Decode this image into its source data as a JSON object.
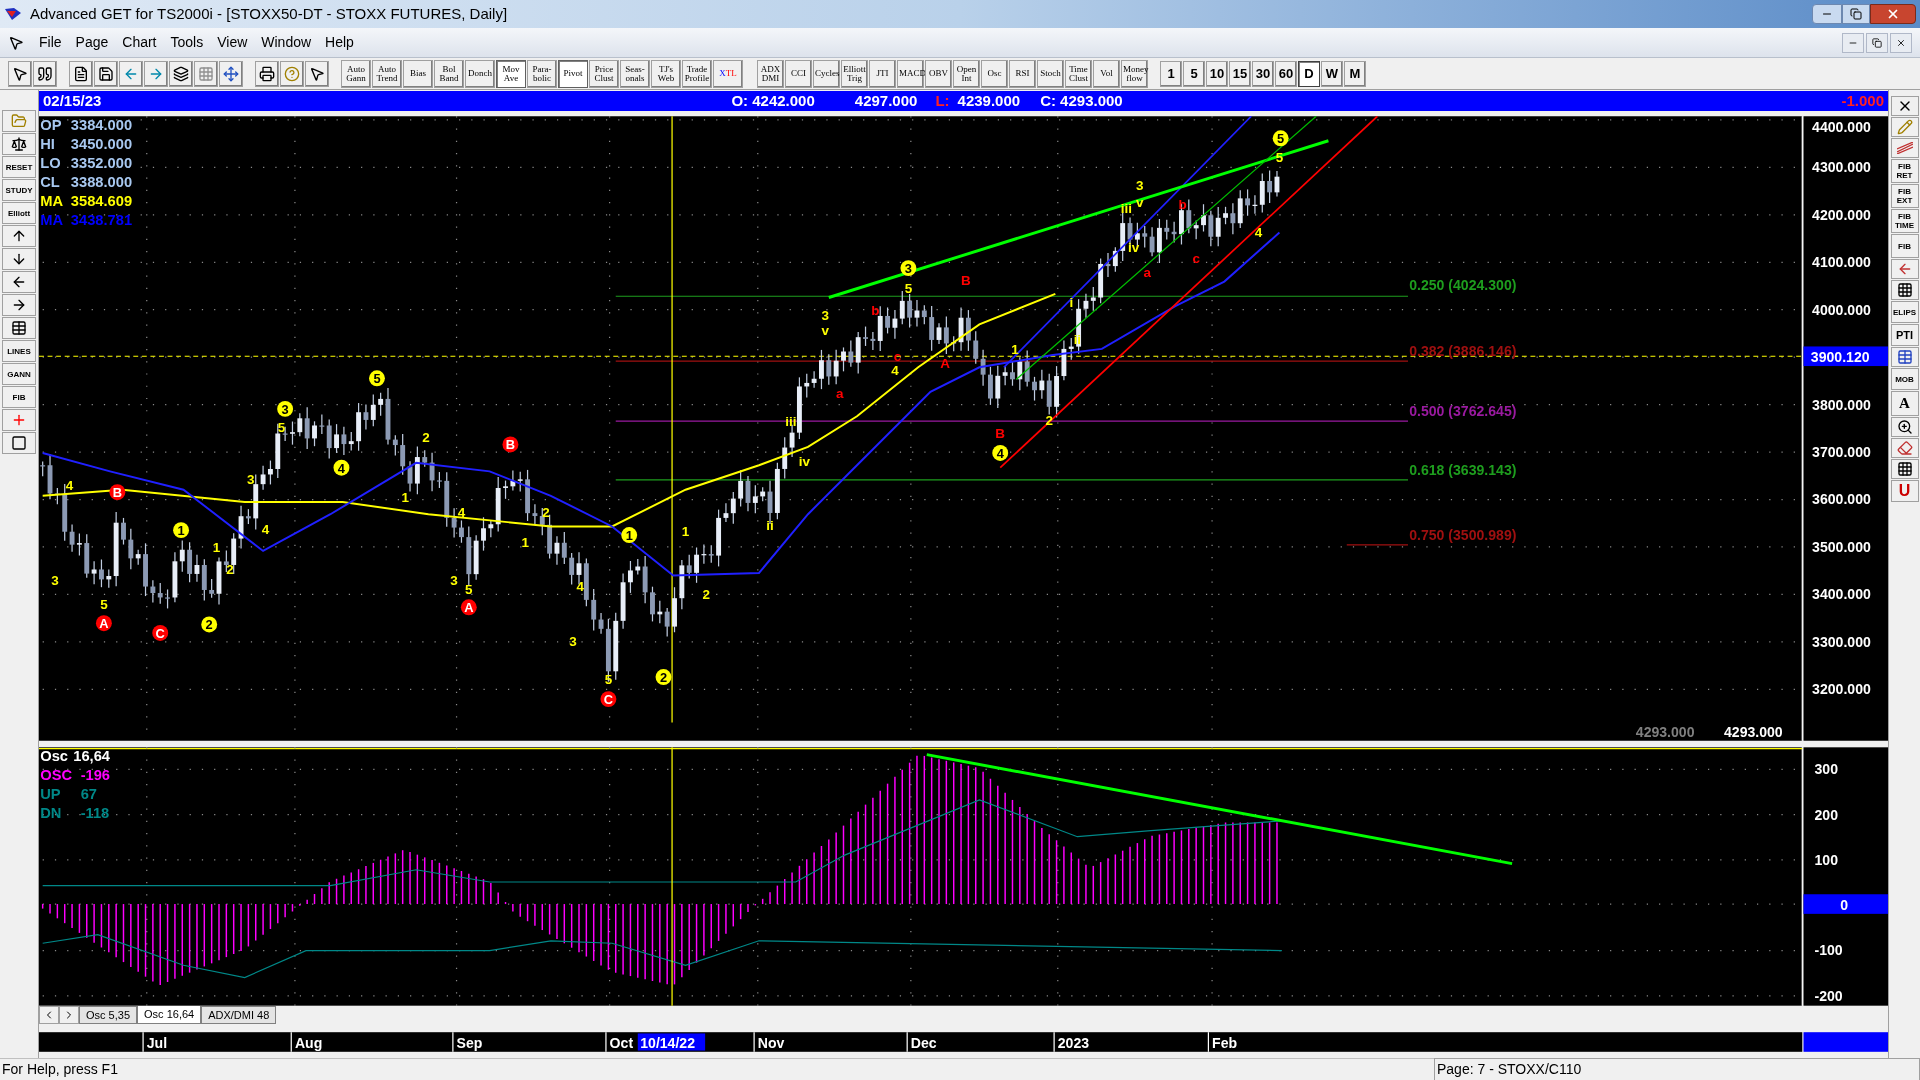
{
  "window": {
    "title": "Advanced GET for TS2000i - [STOXX50-DT - STOXX FUTURES, Daily]"
  },
  "menu": [
    "File",
    "Page",
    "Chart",
    "Tools",
    "View",
    "Window",
    "Help"
  ],
  "toolbar": {
    "study_buttons": [
      {
        "label": "Auto Gann",
        "pressed": false
      },
      {
        "label": "Auto Trend",
        "pressed": false
      },
      {
        "label": "Bias",
        "pressed": false
      },
      {
        "label": "Bol Band",
        "pressed": false
      },
      {
        "label": "Donch",
        "pressed": false
      },
      {
        "label": "Mov Ave",
        "pressed": true
      },
      {
        "label": "Para-bolic",
        "pressed": false
      },
      {
        "label": "Pivot",
        "pressed": true
      },
      {
        "label": "Price Clust",
        "pressed": false
      },
      {
        "label": "Seas-onals",
        "pressed": false
      },
      {
        "label": "TJ's Web",
        "pressed": false
      },
      {
        "label": "Trade Profile",
        "pressed": false
      },
      {
        "label": "XTL",
        "pressed": false
      }
    ],
    "indicator_buttons": [
      "ADX DMI",
      "CCI",
      "Cycles",
      "Elliott Trig",
      "JTI",
      "MACD",
      "OBV",
      "Open Int",
      "Osc",
      "RSI",
      "Stoch",
      "Time Clust",
      "Vol",
      "Money flow"
    ],
    "period_buttons": [
      {
        "label": "1",
        "selected": false
      },
      {
        "label": "5",
        "selected": false
      },
      {
        "label": "10",
        "selected": false
      },
      {
        "label": "15",
        "selected": false
      },
      {
        "label": "30",
        "selected": false
      },
      {
        "label": "60",
        "selected": false
      },
      {
        "label": "D",
        "selected": true
      },
      {
        "label": "W",
        "selected": false
      },
      {
        "label": "M",
        "selected": false
      }
    ]
  },
  "quote_bar": {
    "date": "02/15/23",
    "open": "O: 4242.000",
    "high": "4297.000",
    "low_label": "L:",
    "low": "4239.000",
    "close": "C: 4293.000",
    "change": "-1.000"
  },
  "price_legend": [
    {
      "label": "OP",
      "value": "3384.000",
      "color": "#a8c8f0"
    },
    {
      "label": "HI",
      "value": "3450.000",
      "color": "#a8c8f0"
    },
    {
      "label": "LO",
      "value": "3352.000",
      "color": "#a8c8f0"
    },
    {
      "label": "CL",
      "value": "3388.000",
      "color": "#a8c8f0"
    },
    {
      "label": "MA",
      "value": "3584.609",
      "color": "#ffff00"
    },
    {
      "label": "MA",
      "value": "3438.781",
      "color": "#0000ff"
    }
  ],
  "wave_labels": [
    {
      "text": "4",
      "color": "#ffff00",
      "circled": false
    },
    {
      "text": "3",
      "color": "#ffff00",
      "circled": false
    },
    {
      "text": "5",
      "color": "#ffff00",
      "circled": false
    },
    {
      "text": "A",
      "color": "#ff0000",
      "circled": true
    },
    {
      "text": "B",
      "color": "#ff0000",
      "circled": true
    },
    {
      "text": "C",
      "color": "#ff0000",
      "circled": true
    },
    {
      "text": "1",
      "color": "#ffff00",
      "circled": true
    },
    {
      "text": "2",
      "color": "#ffff00",
      "circled": true
    },
    {
      "text": "1",
      "color": "#ffff00",
      "circled": false
    },
    {
      "text": "2",
      "color": "#ffff00",
      "circled": false
    },
    {
      "text": "3",
      "color": "#ffff00",
      "circled": false
    },
    {
      "text": "4",
      "color": "#ffff00",
      "circled": false
    },
    {
      "text": "3",
      "color": "#ffff00",
      "circled": true
    },
    {
      "text": "5",
      "color": "#ffff00",
      "circled": false
    },
    {
      "text": "4",
      "color": "#ffff00",
      "circled": true
    },
    {
      "text": "5",
      "color": "#ffff00",
      "circled": true
    },
    {
      "text": "1",
      "color": "#ffff00",
      "circled": false
    },
    {
      "text": "2",
      "color": "#ffff00",
      "circled": false
    },
    {
      "text": "4",
      "color": "#ffff00",
      "circled": false
    },
    {
      "text": "3",
      "color": "#ffff00",
      "circled": false
    },
    {
      "text": "5",
      "color": "#ffff00",
      "circled": false
    },
    {
      "text": "A",
      "color": "#ff0000",
      "circled": true
    },
    {
      "text": "B",
      "color": "#ff0000",
      "circled": true
    },
    {
      "text": "1",
      "color": "#ffff00",
      "circled": false
    },
    {
      "text": "2",
      "color": "#ffff00",
      "circled": false
    },
    {
      "text": "4",
      "color": "#ffff00",
      "circled": false
    },
    {
      "text": "3",
      "color": "#ffff00",
      "circled": false
    },
    {
      "text": "5",
      "color": "#ffff00",
      "circled": false
    },
    {
      "text": "C",
      "color": "#ff0000",
      "circled": true
    },
    {
      "text": "1",
      "color": "#ffff00",
      "circled": true
    },
    {
      "text": "2",
      "color": "#ffff00",
      "circled": true
    },
    {
      "text": "1",
      "color": "#ffff00",
      "circled": false
    },
    {
      "text": "2",
      "color": "#ffff00",
      "circled": false
    },
    {
      "text": "ii",
      "color": "#ffff00",
      "circled": false
    },
    {
      "text": "iii",
      "color": "#ffff00",
      "circled": false
    },
    {
      "text": "iv",
      "color": "#ffff00",
      "circled": false
    },
    {
      "text": "3",
      "color": "#ffff00",
      "circled": false
    },
    {
      "text": "v",
      "color": "#ffff00",
      "circled": false
    },
    {
      "text": "a",
      "color": "#ff0000",
      "circled": false
    },
    {
      "text": "b",
      "color": "#ff0000",
      "circled": false
    },
    {
      "text": "c",
      "color": "#ff0000",
      "circled": false
    },
    {
      "text": "4",
      "color": "#ffff00",
      "circled": false
    },
    {
      "text": "3",
      "color": "#ffff00",
      "circled": true
    },
    {
      "text": "5",
      "color": "#ffff00",
      "circled": false
    },
    {
      "text": "A",
      "color": "#ff0000",
      "circled": false
    },
    {
      "text": "B",
      "color": "#ff0000",
      "circled": false
    },
    {
      "text": "1",
      "color": "#ffff00",
      "circled": false
    },
    {
      "text": "B",
      "color": "#ff0000",
      "circled": false
    },
    {
      "text": "4",
      "color": "#ffff00",
      "circled": true
    },
    {
      "text": "2",
      "color": "#ffff00",
      "circled": false
    },
    {
      "text": "i",
      "color": "#ffff00",
      "circled": false
    },
    {
      "text": "ii",
      "color": "#ffff00",
      "circled": false
    },
    {
      "text": "iii",
      "color": "#ffff00",
      "circled": false
    },
    {
      "text": "3",
      "color": "#ffff00",
      "circled": false
    },
    {
      "text": "v",
      "color": "#ffff00",
      "circled": false
    },
    {
      "text": "iv",
      "color": "#ffff00",
      "circled": false
    },
    {
      "text": "a",
      "color": "#ff0000",
      "circled": false
    },
    {
      "text": "b",
      "color": "#ff0000",
      "circled": false
    },
    {
      "text": "c",
      "color": "#ff0000",
      "circled": false
    },
    {
      "text": "4",
      "color": "#ffff00",
      "circled": false
    },
    {
      "text": "5",
      "color": "#ffff00",
      "circled": true
    },
    {
      "text": "5",
      "color": "#ffff00",
      "circled": false
    }
  ],
  "fib_levels": [
    {
      "text": "0.250 (4024.300)",
      "color": "#1e9e1e"
    },
    {
      "text": "0.382 (3886.146)",
      "color": "#a01010"
    },
    {
      "text": "0.500 (3762.645)",
      "color": "#9a1aa0"
    },
    {
      "text": "0.618 (3639.143)",
      "color": "#1e9e1e"
    },
    {
      "text": "0.750 (3500.989)",
      "color": "#a01010"
    }
  ],
  "price_axis": {
    "labels": [
      "4400.000",
      "4300.000",
      "4200.000",
      "4100.000",
      "4000.000",
      "3800.000",
      "3700.000",
      "3600.000",
      "3500.000",
      "3400.000",
      "3300.000",
      "3200.000"
    ],
    "marker": "3900.120",
    "last_values": [
      "4293.000",
      "4293.000"
    ]
  },
  "oscillator": {
    "legend": [
      {
        "label": "Osc",
        "value": "16,64",
        "color": "#ffffff"
      },
      {
        "label": "OSC",
        "value": "-196",
        "color": "#ff00ff"
      },
      {
        "label": "UP",
        "value": "67",
        "color": "#008888"
      },
      {
        "label": "DN",
        "value": "-118",
        "color": "#008888"
      }
    ],
    "axis_labels": [
      "300",
      "200",
      "100",
      "-100",
      "-200"
    ],
    "zero": "0"
  },
  "tabs": [
    {
      "label": "Osc 5,35",
      "selected": false
    },
    {
      "label": "Osc 16,64",
      "selected": true
    },
    {
      "label": "ADX/DMI 48",
      "selected": false
    }
  ],
  "date_axis": {
    "labels": [
      "Jul",
      "Aug",
      "Sep",
      "Oct",
      "Nov",
      "Dec",
      "2023",
      "Feb"
    ],
    "cursor_date": "10/14/22"
  },
  "left_tools": [
    "RESET",
    "STUDY",
    "Elliott",
    "LINES",
    "GANN",
    "FIB"
  ],
  "right_tools": [
    "FIB RET",
    "FIB EXT",
    "FIB TIME",
    "FIB",
    "ELIPS",
    "PTI",
    "MOB",
    "A",
    "U"
  ],
  "status_bar": {
    "help": "For Help, press F1",
    "page": "Page: 7 - STOXX/C110"
  }
}
